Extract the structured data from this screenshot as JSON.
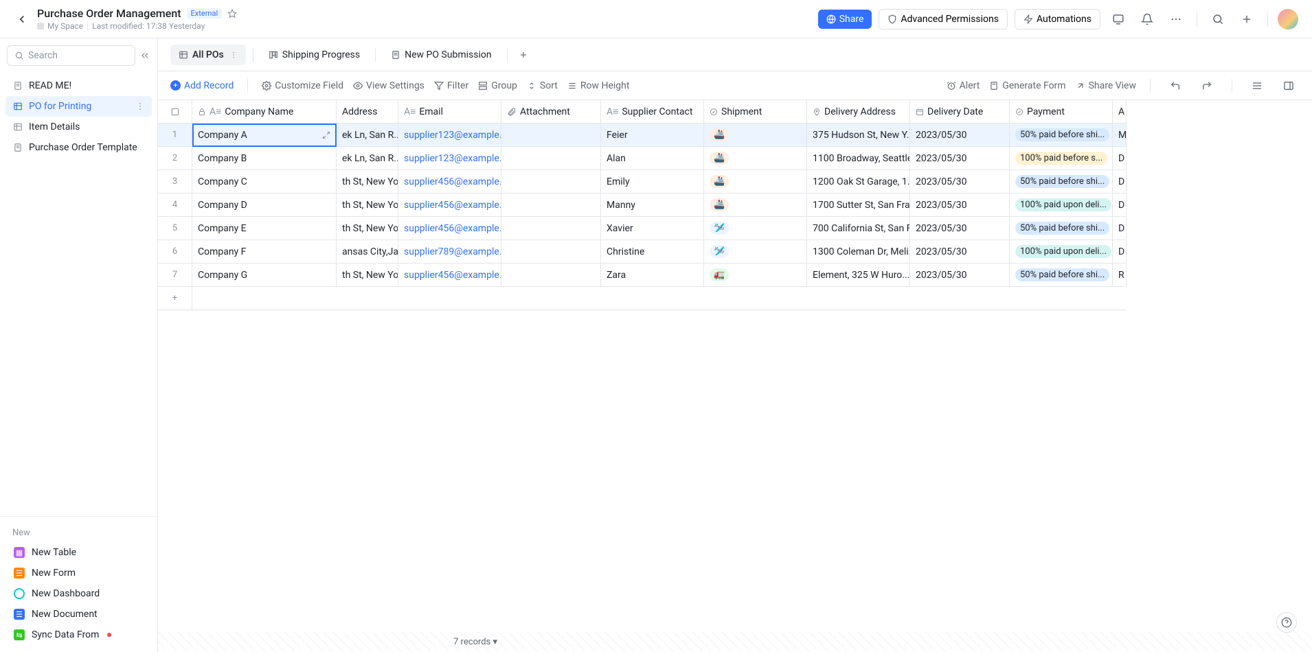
{
  "header": {
    "title": "Purchase Order Management",
    "external_badge": "External",
    "space": "My Space",
    "last_modified": "Last modified: 17:38 Yesterday",
    "share": "Share",
    "advanced_permissions": "Advanced Permissions",
    "automations": "Automations"
  },
  "sidebar": {
    "search_placeholder": "Search",
    "items": [
      {
        "label": "READ ME!"
      },
      {
        "label": "PO for Printing"
      },
      {
        "label": "Item Details"
      },
      {
        "label": "Purchase Order Template"
      }
    ],
    "new_label": "New",
    "new_items": [
      {
        "label": "New Table"
      },
      {
        "label": "New Form"
      },
      {
        "label": "New Dashboard"
      },
      {
        "label": "New Document"
      },
      {
        "label": "Sync Data From"
      }
    ]
  },
  "tabs": [
    {
      "label": "All POs"
    },
    {
      "label": "Shipping Progress"
    },
    {
      "label": "New PO Submission"
    }
  ],
  "toolbar": {
    "add_record": "Add Record",
    "customize_field": "Customize Field",
    "view_settings": "View Settings",
    "filter": "Filter",
    "group": "Group",
    "sort": "Sort",
    "row_height": "Row Height",
    "alert": "Alert",
    "generate_form": "Generate Form",
    "share_view": "Share View"
  },
  "columns": [
    "Company Name",
    "Address",
    "Email",
    "Attachment",
    "Supplier Contact",
    "Shipment",
    "Delivery Address",
    "Delivery Date",
    "Payment",
    "A"
  ],
  "rows": [
    {
      "n": 1,
      "company": "Company A",
      "address": "ek Ln, San R...",
      "email": "supplier123@example....",
      "contact": "Feier",
      "ship_type": "ship",
      "delivery_addr": "375 Hudson St, New Y...",
      "date": "2023/05/30",
      "pay": "50% paid before shi...",
      "pay_class": "pay-a",
      "last": "M"
    },
    {
      "n": 2,
      "company": "Company B",
      "address": "ek Ln, San R...",
      "email": "supplier123@example....",
      "contact": "Alan",
      "ship_type": "ship",
      "delivery_addr": "1100 Broadway, Seattle...",
      "date": "2023/05/30",
      "pay": "100% paid before s...",
      "pay_class": "pay-b",
      "last": "D"
    },
    {
      "n": 3,
      "company": "Company C",
      "address": "th St, New Yo...",
      "email": "supplier456@example....",
      "contact": "Emily",
      "ship_type": "ship",
      "delivery_addr": "1200 Oak St Garage,  1...",
      "date": "2023/05/30",
      "pay": "50% paid before shi...",
      "pay_class": "pay-a",
      "last": "D"
    },
    {
      "n": 4,
      "company": "Company D",
      "address": "th St, New Yo...",
      "email": "supplier456@example....",
      "contact": "Manny",
      "ship_type": "ship",
      "delivery_addr": "1700 Sutter St, San Fra...",
      "date": "2023/05/30",
      "pay": "100% paid upon deli...",
      "pay_class": "pay-c",
      "last": "D"
    },
    {
      "n": 5,
      "company": "Company E",
      "address": "th St, New Yo...",
      "email": "supplier456@example....",
      "contact": "Xavier",
      "ship_type": "plane",
      "delivery_addr": "700 California St, San F...",
      "date": "2023/05/30",
      "pay": "50% paid before shi...",
      "pay_class": "pay-a",
      "last": "D"
    },
    {
      "n": 6,
      "company": "Company F",
      "address": "ansas City,Ja...",
      "email": "supplier789@example....",
      "contact": "Christine",
      "ship_type": "plane",
      "delivery_addr": "1300 Coleman Dr, Meli...",
      "date": "2023/05/30",
      "pay": "100% paid upon deli...",
      "pay_class": "pay-c",
      "last": "D"
    },
    {
      "n": 7,
      "company": "Company G",
      "address": "th St, New Yo...",
      "email": "supplier456@example....",
      "contact": "Zara",
      "ship_type": "truck",
      "delivery_addr": "Element,  325 W Huro...",
      "date": "2023/05/30",
      "pay": "50% paid before shi...",
      "pay_class": "pay-a",
      "last": "R"
    }
  ],
  "footer": {
    "record_count": "7 records"
  },
  "ship_emoji": {
    "ship": "🚢",
    "plane": "🛩️",
    "truck": "🚛"
  }
}
